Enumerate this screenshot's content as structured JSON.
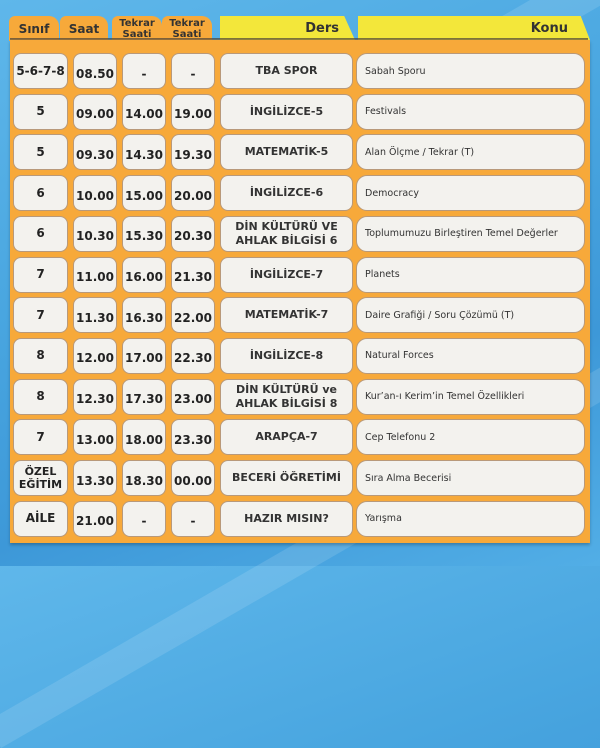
{
  "header": {
    "columns": [
      {
        "key": "sinif",
        "label": "Sınıf"
      },
      {
        "key": "saat",
        "label": "Saat"
      },
      {
        "key": "tekrar1",
        "label": "Tekrar Saati"
      },
      {
        "key": "tekrar2",
        "label": "Tekrar Saati"
      },
      {
        "key": "ders",
        "label": "Ders"
      },
      {
        "key": "konu",
        "label": "Konu"
      }
    ]
  },
  "colors": {
    "background": "#49a6e0",
    "panel": "#f7a93a",
    "cell": "#f3f2ee",
    "tab_yellow": "#f3e73a",
    "cell_border": "#b8997a"
  },
  "rows": [
    {
      "sinif": "5-6-7-8",
      "saat": "08.50",
      "tekrar1": "-",
      "tekrar2": "-",
      "ders": "TBA SPOR",
      "konu": "Sabah Sporu"
    },
    {
      "sinif": "5",
      "saat": "09.00",
      "tekrar1": "14.00",
      "tekrar2": "19.00",
      "ders": "İNGİLİZCE-5",
      "konu": "Festivals"
    },
    {
      "sinif": "5",
      "saat": "09.30",
      "tekrar1": "14.30",
      "tekrar2": "19.30",
      "ders": "MATEMATİK-5",
      "konu": "Alan Ölçme / Tekrar (T)"
    },
    {
      "sinif": "6",
      "saat": "10.00",
      "tekrar1": "15.00",
      "tekrar2": "20.00",
      "ders": "İNGİLİZCE-6",
      "konu": "Democracy"
    },
    {
      "sinif": "6",
      "saat": "10.30",
      "tekrar1": "15.30",
      "tekrar2": "20.30",
      "ders": "DİN KÜLTÜRÜ VE AHLAK BİLGİSİ 6",
      "konu": "Toplumumuzu Birleştiren Temel Değerler"
    },
    {
      "sinif": "7",
      "saat": "11.00",
      "tekrar1": "16.00",
      "tekrar2": "21.30",
      "ders": "İNGİLİZCE-7",
      "konu": "Planets"
    },
    {
      "sinif": "7",
      "saat": "11.30",
      "tekrar1": "16.30",
      "tekrar2": "22.00",
      "ders": "MATEMATİK-7",
      "konu": "Daire Grafiği / Soru Çözümü (T)"
    },
    {
      "sinif": "8",
      "saat": "12.00",
      "tekrar1": "17.00",
      "tekrar2": "22.30",
      "ders": "İNGİLİZCE-8",
      "konu": "Natural Forces"
    },
    {
      "sinif": "8",
      "saat": "12.30",
      "tekrar1": "17.30",
      "tekrar2": "23.00",
      "ders": "DİN KÜLTÜRÜ ve AHLAK BİLGİSİ 8",
      "konu": "Kur’an-ı Kerim’in Temel Özellikleri"
    },
    {
      "sinif": "7",
      "saat": "13.00",
      "tekrar1": "18.00",
      "tekrar2": "23.30",
      "ders": "ARAPÇA-7",
      "konu": "Cep Telefonu 2"
    },
    {
      "sinif": "ÖZEL EĞİTİM",
      "saat": "13.30",
      "tekrar1": "18.30",
      "tekrar2": "00.00",
      "ders": "BECERİ ÖĞRETİMİ",
      "konu": "Sıra Alma Becerisi"
    },
    {
      "sinif": "AİLE",
      "saat": "21.00",
      "tekrar1": "-",
      "tekrar2": "-",
      "ders": "HAZIR MISIN?",
      "konu": "Yarışma"
    }
  ]
}
